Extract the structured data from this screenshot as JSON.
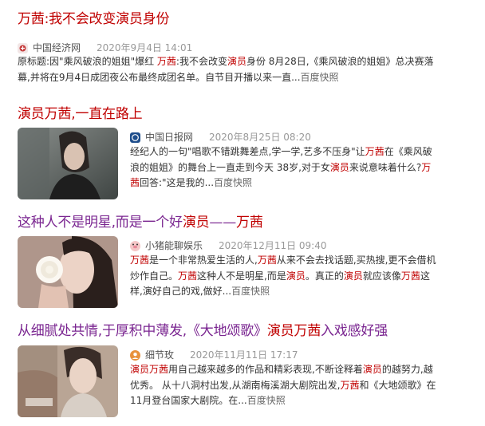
{
  "results": [
    {
      "title_parts": [
        "万茜",
        ":我不会改变",
        "演员",
        "身份"
      ],
      "source": "中国经济网",
      "date": "2020年9月4日 14:01",
      "abstract_lines": [
        [
          "原标题:因\"乘风破浪的姐姐\"爆红 ",
          "万茜",
          ":我不会改变",
          "演员",
          "身份 8月28日,《乘风破浪的姐姐》总决赛落"
        ],
        [
          "幕,并将在9月4日成团夜公布最终成团名单。自节目开播以来一直..."
        ]
      ],
      "snapshot": "百度快照"
    },
    {
      "title_parts": [
        "演员",
        "万茜",
        ",一直在路上"
      ],
      "source": "中国日报网",
      "date": "2020年8月25日 08:20",
      "abstract_lines": [
        [
          "经纪人的一句\"唱歌不错跳舞差点,学一学,艺多不压身\"让",
          "万茜",
          "在《乘风破"
        ],
        [
          "浪的姐姐》的舞台上一直走到今天 38岁,对于女",
          "演员",
          "来说意味着什么?",
          "万"
        ],
        [
          "茜",
          "回答:\"这是我的..."
        ]
      ],
      "snapshot": "百度快照"
    },
    {
      "title_parts": [
        "这种人不是明星,而是一个好",
        "演员",
        "——",
        "万茜"
      ],
      "source": "小猪能聊娱乐",
      "date": "2020年12月11日 09:40",
      "abstract_lines": [
        [
          "万茜",
          "是一个非常热爱生活的人,",
          "万茜",
          "从来不会去找话题,买热搜,更不会借机"
        ],
        [
          "炒作自己。",
          "万茜",
          "这种人不是明星,而是",
          "演员",
          "。真正的",
          "演员",
          "就应该像",
          "万茜",
          "这"
        ],
        [
          "样,演好自己的戏,做好..."
        ]
      ],
      "snapshot": "百度快照"
    },
    {
      "title_parts": [
        "从细腻处共情,于厚积中薄发,《大地颂歌》",
        "演员",
        "万茜",
        "入戏感好强"
      ],
      "source": "细节玫",
      "date": "2020年11月11日 17:17",
      "abstract_lines": [
        [
          "演员",
          "万茜",
          "用自己越来越多的作品和精彩表现,不断诠释着",
          "演员",
          "的越努力,越"
        ],
        [
          "优秀。 从十八洞村出发,从湖南梅溪湖大剧院出发,",
          "万茜",
          "和《大地颂歌》在"
        ],
        [
          "11月登台国家大剧院。在..."
        ]
      ],
      "snapshot": "百度快照"
    }
  ],
  "colors": {
    "link": "#2440b3",
    "visited": "#7a2590",
    "highlight": "#c00000"
  },
  "icons": [
    "china-economy-favicon",
    "china-daily-favicon",
    "piggy-avatar-icon",
    "detail-avatar-icon"
  ]
}
